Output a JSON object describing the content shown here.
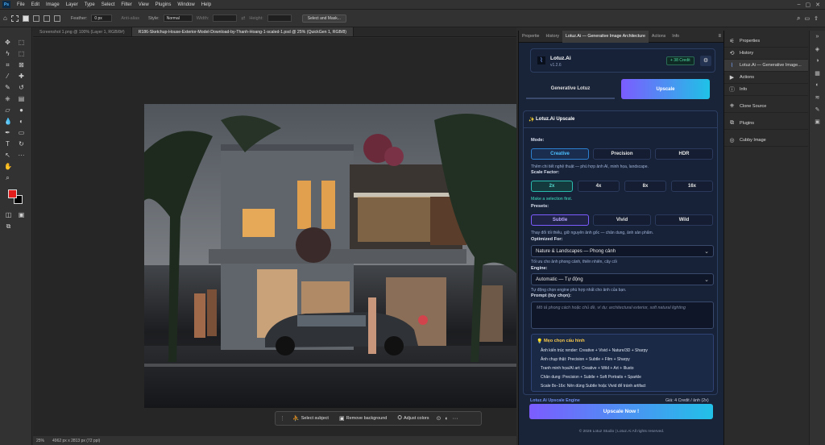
{
  "app": {
    "logo": "Ps"
  },
  "menu": [
    "File",
    "Edit",
    "Image",
    "Layer",
    "Type",
    "Select",
    "Filter",
    "View",
    "Plugins",
    "Window",
    "Help"
  ],
  "options": {
    "feather_label": "Feather:",
    "feather_value": "0 px",
    "antialias": "Anti-alias",
    "style_label": "Style:",
    "style_value": "Normal",
    "width_label": "Width:",
    "height_label": "Height:",
    "select_mask": "Select and Mask..."
  },
  "doc_tabs": [
    {
      "label": "Screenshot 1.png @ 100% (Layer 1, RGB/8#)",
      "active": false
    },
    {
      "label": "R186-Sketchup-House-Exterior-Model-Download-by-Thanh-Hoang-1-scaled-1.psd @ 25% (QuickGen 1, RGB/8)",
      "active": true
    }
  ],
  "status": {
    "zoom": "25%",
    "size": "4962 px x 2813 px (72 ppi)"
  },
  "context_bar": {
    "select_subject": "Select subject",
    "remove_bg": "Remove background",
    "adjust_colors": "Adjust colors"
  },
  "panel_tabs": [
    "Propertie",
    "History",
    "Lotuz.Ai — Generative Image Architecture",
    "Actions",
    "Info"
  ],
  "plugin": {
    "name": "Lotuz.Ai",
    "version": "v1.2.6",
    "credit": "+ 38 Credit",
    "tabs": {
      "generative": "Generative Lotuz",
      "upscale": "Upscale"
    },
    "section_title": "Lotuz.Ai Upscale",
    "mode_label": "Mode:",
    "modes": [
      "Creative",
      "Precision",
      "HDR"
    ],
    "mode_note": "Thêm chi tiết nghệ thuật — phù hợp ảnh AI, minh họa, landscape.",
    "scale_label": "Scale Factor:",
    "scales": [
      "2x",
      "4x",
      "8x",
      "16x"
    ],
    "selection_warning": "Make a selection first.",
    "presets_label": "Presets:",
    "presets": [
      "Subtle",
      "Vivid",
      "Wild"
    ],
    "preset_note": "Thay đổi tối thiểu, giữ nguyên ảnh gốc — chân dung, ảnh sản phẩm.",
    "optimized_label": "Optimized For:",
    "optimized_value": "Nature & Landscapes — Phong cảnh",
    "optimized_note": "Tối ưu cho ảnh phong cảnh, thiên nhiên, cây cối",
    "engine_label": "Engine:",
    "engine_value": "Automatic — Tự động",
    "engine_note": "Tự động chọn engine phù hợp nhất cho ảnh của bạn.",
    "prompt_label": "Prompt (tùy chọn):",
    "prompt_placeholder": "Mô tả phong cách hoặc chủ đề, ví dụ: architectural exterior, soft natural lighting",
    "tips_title": "Mẹo chọn cấu hình",
    "tips": [
      "Ảnh kiến trúc render: Creative + Vivid + Nature/3D + Sharpy",
      "Ảnh chụp thật: Precision + Subtle + Film + Sharpy",
      "Tranh minh họa/AI art: Creative + Wild + Art + Illusto",
      "Chân dung: Precision + Subtle + Soft Portraits + Sparkle",
      "Scale 8x–16x: Nên dùng Subtle hoặc Vivid để tránh artifact"
    ],
    "engine_footer": "Lotuz.Ai Upscale Engine",
    "cost": "Giá: 4 Credit / ảnh (2x)",
    "upscale_button": "Upscale Now !",
    "copyright": "© 2026 Lotuz Studio | Lotuz.Ai All rights reserved."
  },
  "dock": [
    "Properties",
    "History",
    "Lotuz.Ai — Generative Image...",
    "Actions",
    "Info",
    "Clone Source",
    "Plugins",
    "Cubby Image"
  ],
  "colors": {
    "foreground": "#e31c1c",
    "background": "#000000",
    "accent": "#7c5cff",
    "cyan": "#22c1e8"
  }
}
